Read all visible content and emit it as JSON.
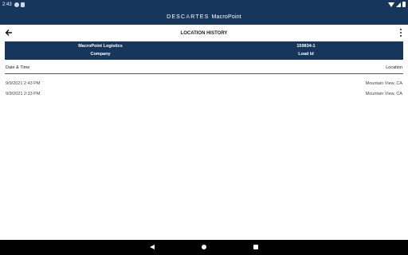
{
  "status_bar": {
    "time": "2:43",
    "icons": [
      "circle-p-icon",
      "sd-card-icon",
      "wifi-icon",
      "signal-icon",
      "battery-icon"
    ]
  },
  "brand": {
    "name": "DESC",
    "name_mid": "A",
    "name_end": "RTES",
    "product": "MacroPoint"
  },
  "toolbar": {
    "title": "LOCATION HISTORY"
  },
  "info": {
    "company_value": "MacroPoint Logistics",
    "company_label": "Company",
    "load_value": "159834-1",
    "load_label": "Load Id"
  },
  "table": {
    "columns": {
      "datetime": "Date & Time",
      "location": "Location"
    },
    "rows": [
      {
        "datetime": "9/9/2021 2:43 PM",
        "location": "Mountain View, CA"
      },
      {
        "datetime": "9/9/2021 2:33 PM",
        "location": "Mountain View, CA"
      }
    ]
  },
  "colors": {
    "header_bg": "#17365c",
    "nav_bg": "#000000"
  }
}
